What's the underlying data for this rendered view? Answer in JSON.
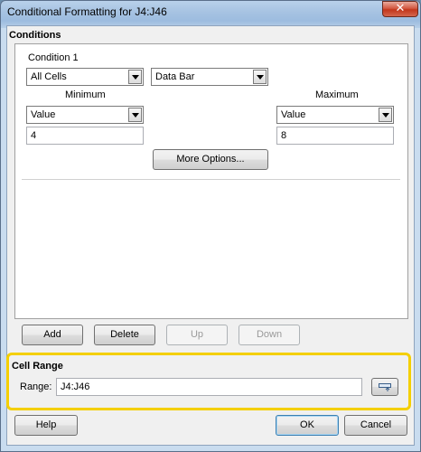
{
  "window": {
    "title": "Conditional Formatting for J4:J46",
    "close_glyph": "✕"
  },
  "conditions": {
    "heading": "Conditions",
    "condition_title": "Condition 1",
    "applies_to": "All Cells",
    "type": "Data Bar",
    "minimum_label": "Minimum",
    "maximum_label": "Maximum",
    "min_kind": "Value",
    "max_kind": "Value",
    "min_value": "4",
    "max_value": "8",
    "more_options": "More Options..."
  },
  "list_buttons": {
    "add": "Add",
    "delete": "Delete",
    "up": "Up",
    "down": "Down"
  },
  "cell_range": {
    "heading": "Cell Range",
    "range_label": "Range:",
    "range_value": "J4:J46",
    "highlight_color": "#f4cf00"
  },
  "footer": {
    "help": "Help",
    "ok": "OK",
    "cancel": "Cancel"
  }
}
